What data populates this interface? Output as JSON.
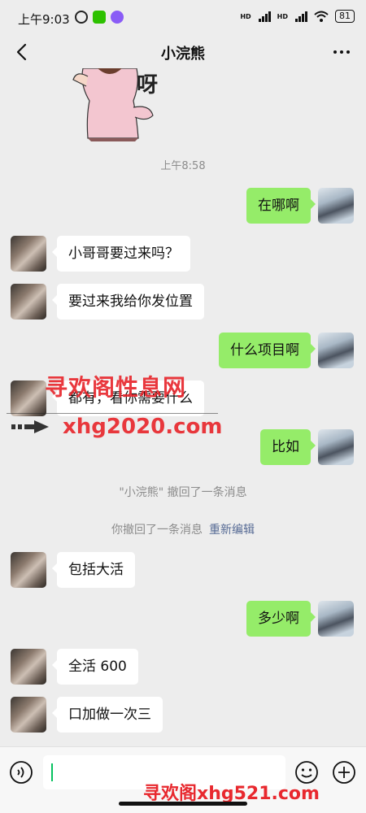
{
  "status_bar": {
    "time": "上午9:03",
    "hd1": "HD",
    "hd2": "HD",
    "battery": "81"
  },
  "header": {
    "title": "小浣熊"
  },
  "sticker": {
    "text": "呀"
  },
  "timestamp": "上午8:58",
  "messages": [
    {
      "side": "right",
      "text": "在哪啊"
    },
    {
      "side": "left",
      "text": "小哥哥要过来吗？"
    },
    {
      "side": "left",
      "text": "要过来我给你发位置"
    },
    {
      "side": "right",
      "text": "什么项目啊"
    },
    {
      "side": "left",
      "text": "都有，看你需要什么"
    },
    {
      "side": "right",
      "text": "比如"
    },
    {
      "side": "left",
      "text": "包括大活"
    },
    {
      "side": "right",
      "text": "多少啊"
    },
    {
      "side": "left",
      "text": "全活 600"
    },
    {
      "side": "left",
      "text": "口加做一次三"
    }
  ],
  "system_messages": {
    "recalled_by_other": "\"小浣熊\" 撤回了一条消息",
    "recalled_by_me": "你撤回了一条消息",
    "re_edit": "重新编辑"
  },
  "watermark": {
    "site_name": "寻欢阁性息网",
    "site_url": "xhg2020.com",
    "bottom": "寻欢阁xhg521.com"
  },
  "colors": {
    "sent_bubble": "#95ec69",
    "received_bubble": "#ffffff",
    "background": "#ededed",
    "link": "#576b95",
    "watermark": "#e8282e"
  },
  "icons": [
    "back-arrow-icon",
    "more-icon",
    "voice-icon",
    "emoji-icon",
    "plus-icon"
  ]
}
